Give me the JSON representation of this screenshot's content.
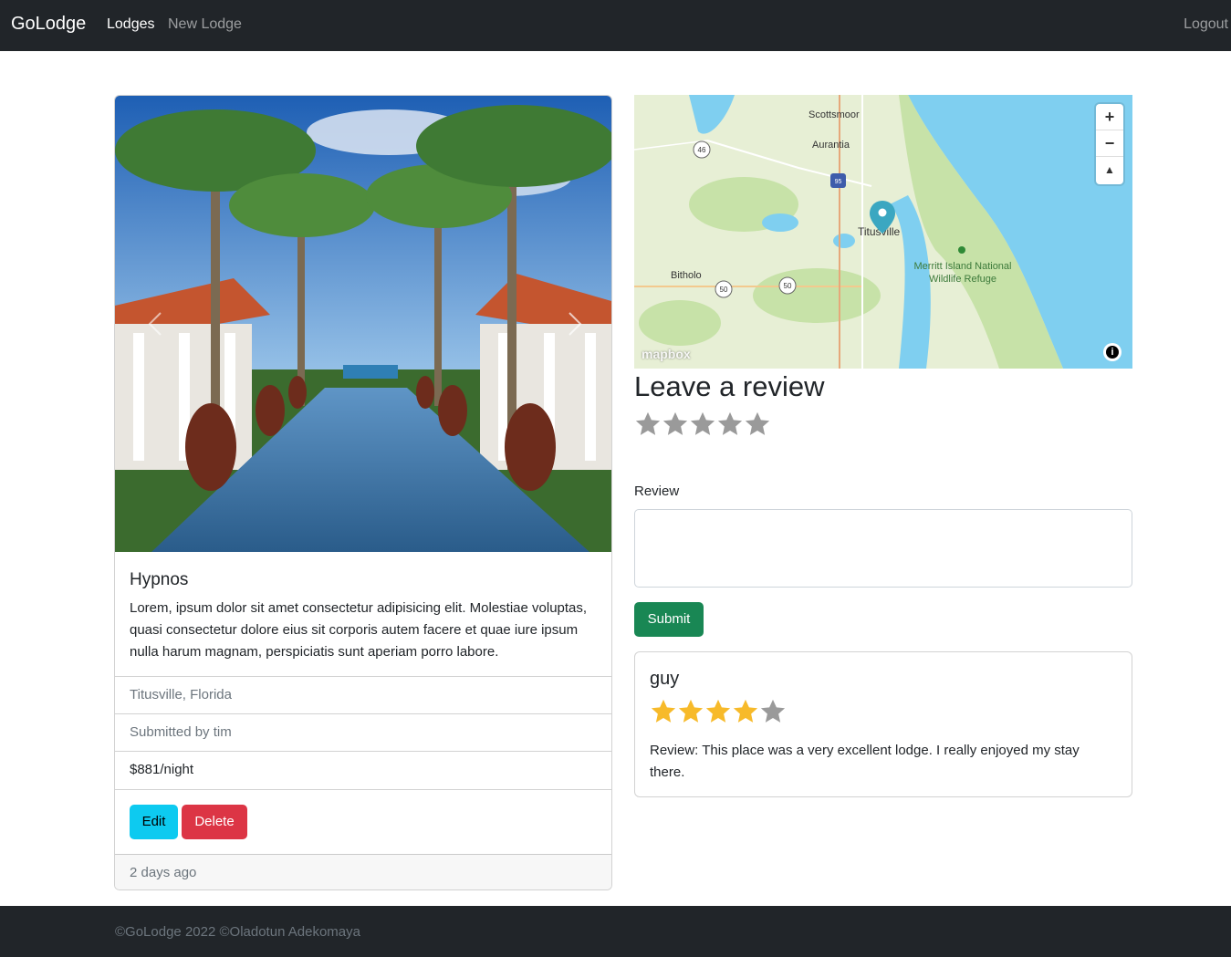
{
  "navbar": {
    "brand": "GoLodge",
    "links": [
      "Lodges",
      "New Lodge"
    ],
    "logout": "Logout"
  },
  "lodge": {
    "title": "Hypnos",
    "description": "Lorem, ipsum dolor sit amet consectetur adipisicing elit. Molestiae voluptas, quasi consectetur dolore eius sit corporis autem facere et quae iure ipsum nulla harum magnam, perspiciatis sunt aperiam porro labore.",
    "location": "Titusville, Florida",
    "submitted_by": "Submitted by tim",
    "price": "$881/night",
    "edit_label": "Edit",
    "delete_label": "Delete",
    "posted": "2 days ago"
  },
  "map": {
    "places": [
      "Scottsmoor",
      "Aurantia",
      "Titusville",
      "Bitholo",
      "Merritt Island National",
      "Wildlife Refuge"
    ],
    "routes": [
      "46",
      "95",
      "50",
      "50"
    ],
    "logo": "mapbox",
    "controls": [
      "+",
      "−",
      "▲"
    ],
    "info": "i"
  },
  "review_form": {
    "title": "Leave a review",
    "rating": 0,
    "max_rating": 5,
    "label": "Review",
    "textarea_value": "",
    "submit_label": "Submit"
  },
  "reviews": [
    {
      "author": "guy",
      "rating": 4,
      "max_rating": 5,
      "text": "Review: This place was a very excellent lodge. I really enjoyed my stay there."
    }
  ],
  "footer": {
    "text": "©GoLodge 2022 ©Oladotun Adekomaya"
  },
  "colors": {
    "navbar": "#212529",
    "star_filled": "#f7ba2a",
    "star_empty": "#9a9a9a",
    "edit": "#0dcaf0",
    "delete": "#dc3545",
    "submit": "#198754"
  }
}
